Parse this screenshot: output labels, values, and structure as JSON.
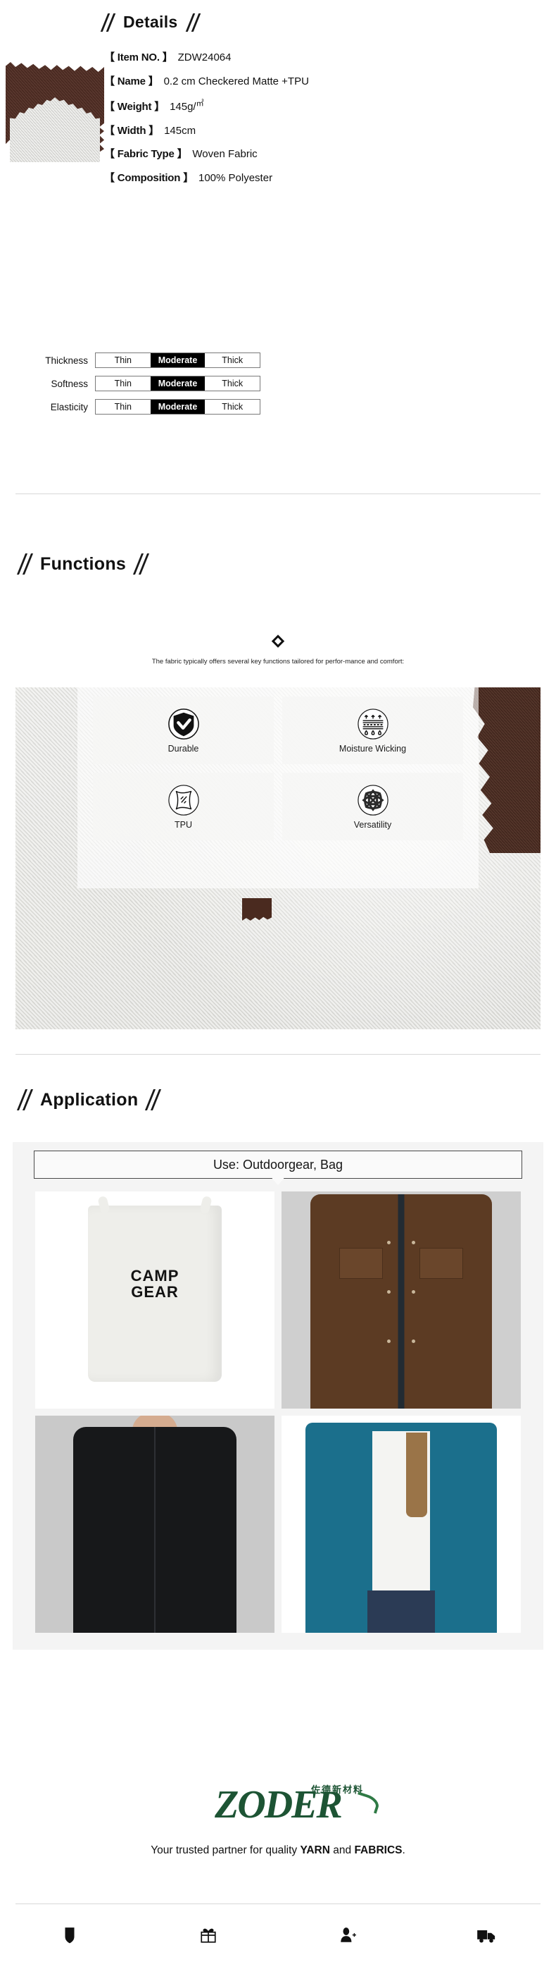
{
  "sections": {
    "details": {
      "title": "Details"
    },
    "functions": {
      "title": "Functions"
    },
    "application": {
      "title": "Application"
    }
  },
  "details": {
    "specs": [
      {
        "key": "【 Item NO. 】",
        "value": "ZDW24064"
      },
      {
        "key": "【 Name 】",
        "value": "0.2 cm Checkered Matte +TPU"
      },
      {
        "key": "【 Weight 】",
        "value": "145g/",
        "sup": "㎡"
      },
      {
        "key": "【 Width 】",
        "value": "145cm"
      },
      {
        "key": "【 Fabric Type 】",
        "value": "Woven Fabric"
      },
      {
        "key": "【 Composition 】",
        "value": "100% Polyester"
      }
    ],
    "ratings": {
      "scale": [
        "Thin",
        "Moderate",
        "Thick"
      ],
      "rows": [
        {
          "label": "Thickness",
          "selected": "Moderate"
        },
        {
          "label": "Softness",
          "selected": "Moderate"
        },
        {
          "label": "Elasticity",
          "selected": "Moderate"
        }
      ]
    },
    "swatch_colors": {
      "dark": "#4e2a20",
      "light": "#dcdcd8"
    }
  },
  "functions": {
    "description": "The fabric typically offers several key functions tailored for perfor-mance and comfort:",
    "cards": [
      {
        "icon": "shield-check-icon",
        "label": "Durable"
      },
      {
        "icon": "moisture-wicking-icon",
        "label": "Moisture Wicking"
      },
      {
        "icon": "tpu-film-icon",
        "label": "TPU"
      },
      {
        "icon": "knot-weave-icon",
        "label": "Versatility"
      }
    ]
  },
  "application": {
    "use_label": "Use: Outdoorgear, Bag",
    "images": [
      {
        "name": "camp-gear-dry-bag",
        "logo_line1": "CAMP",
        "logo_line2": "GEAR"
      },
      {
        "name": "brown-field-jacket"
      },
      {
        "name": "black-softshell-jacket"
      },
      {
        "name": "teal-rain-jacket"
      }
    ]
  },
  "footer": {
    "brand": "ZODER",
    "brand_cn": "佐德新材料",
    "tagline_pre": "Your trusted partner for quality ",
    "tagline_b1": "YARN",
    "tagline_mid": " and ",
    "tagline_b2": "FABRICS",
    "tagline_end": ".",
    "brand_color": "#1d5434",
    "icons": [
      {
        "name": "shield-icon"
      },
      {
        "name": "gift-icon"
      },
      {
        "name": "add-user-icon"
      },
      {
        "name": "delivery-truck-icon"
      }
    ]
  }
}
